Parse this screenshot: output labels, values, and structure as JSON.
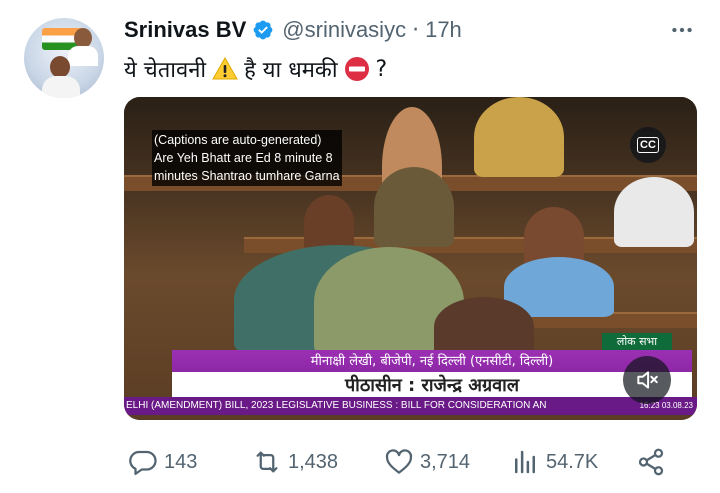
{
  "author": {
    "name": "Srinivas BV",
    "handle": "@srinivasiyc",
    "separator": "·",
    "time": "17h",
    "verified_icon": "verified-badge-icon",
    "avatar": "profile-avatar"
  },
  "tweet": {
    "text_part1": "ये चेतावनी",
    "emoji1": "warning-icon",
    "text_part2": "है या धमकी",
    "emoji2": "no-entry-icon",
    "text_part3": "?"
  },
  "media": {
    "captions_lines": [
      "(Captions are auto-generated)",
      "Are Yeh Bhatt are Ed 8 minute 8",
      "minutes Shantrao tumhare Garna"
    ],
    "cc_label": "CC",
    "channel_badge": "लोक सभा",
    "speaker_line": "मीनाक्षी लेखी, बीजेपी, नई दिल्ली (एनसीटी, दिल्ली)",
    "chair_line": "पीठासीन : राजेन्द्र अग्रवाल",
    "ticker_text": "ELHI (AMENDMENT) BILL, 2023     LEGISLATIVE BUSINESS : BILL FOR CONSIDERATION AN",
    "ticker_stamp": "16:23 03.08.23"
  },
  "actions": {
    "replies": "143",
    "reposts": "1,438",
    "likes": "3,714",
    "views": "54.7K"
  },
  "colors": {
    "verified": "#1d9bf0",
    "muted_text": "#536471",
    "lower_third": "#7a1f96"
  }
}
